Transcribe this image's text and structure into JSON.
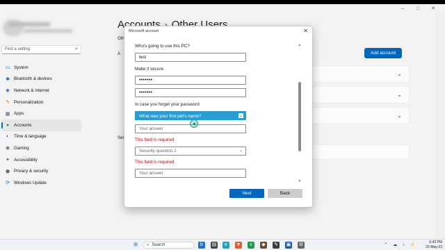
{
  "window": {
    "controls": [
      "–",
      "□",
      "✕"
    ]
  },
  "sidebar": {
    "search_placeholder": "Find a setting",
    "items": [
      {
        "label": "System",
        "icon": "monitor-icon",
        "color": "#0067c0",
        "glyph": "▭"
      },
      {
        "label": "Bluetooth & devices",
        "icon": "bluetooth-icon",
        "color": "#0a66c2",
        "glyph": "✱"
      },
      {
        "label": "Network & internet",
        "icon": "wifi-icon",
        "color": "#3a7bd5",
        "glyph": "◆"
      },
      {
        "label": "Personalization",
        "icon": "brush-icon",
        "color": "#d97a2b",
        "glyph": "✎"
      },
      {
        "label": "Apps",
        "icon": "apps-icon",
        "color": "#4a5a7a",
        "glyph": "▦"
      },
      {
        "label": "Accounts",
        "icon": "person-icon",
        "color": "#1f9d55",
        "glyph": "●",
        "active": true
      },
      {
        "label": "Time & language",
        "icon": "globe-clock-icon",
        "color": "#1a73c9",
        "glyph": "◐"
      },
      {
        "label": "Gaming",
        "icon": "gamepad-icon",
        "color": "#6b6b6b",
        "glyph": "◉"
      },
      {
        "label": "Accessibility",
        "icon": "accessibility-icon",
        "color": "#2560a8",
        "glyph": "✦"
      },
      {
        "label": "Privacy & security",
        "icon": "shield-icon",
        "color": "#6b6b6b",
        "glyph": "⬟"
      },
      {
        "label": "Windows Update",
        "icon": "update-icon",
        "color": "#0067c0",
        "glyph": "⟳"
      }
    ]
  },
  "header": {
    "crumb1": "Accounts",
    "separator": "›",
    "crumb2": "Other Users"
  },
  "main": {
    "add_account_label": "Add account",
    "left_fragments": [
      "Oth",
      "A",
      "Set"
    ]
  },
  "dialog": {
    "title": "Microsoft account",
    "close_glyph": "✕",
    "q1_label": "Who's going to use this PC?",
    "username_value": "test",
    "q2_label": "Make it secure.",
    "password_value": "•••••••",
    "confirm_password_value": "•••••••",
    "q3_label": "In case you forget your password",
    "security_question_1": "What was your first pet's name?",
    "answer_placeholder": "Your answer",
    "error_1": "This field is required",
    "security_question_2": "Security question 2",
    "error_2": "This field is required",
    "answer2_placeholder": "Your answer",
    "next_label": "Next",
    "back_label": "Back"
  },
  "taskbar": {
    "search_label": "Search",
    "time": "6:42 PM",
    "date": "22-May-23",
    "tray_icons": "⌃ ☁ ♪ ⚡"
  }
}
